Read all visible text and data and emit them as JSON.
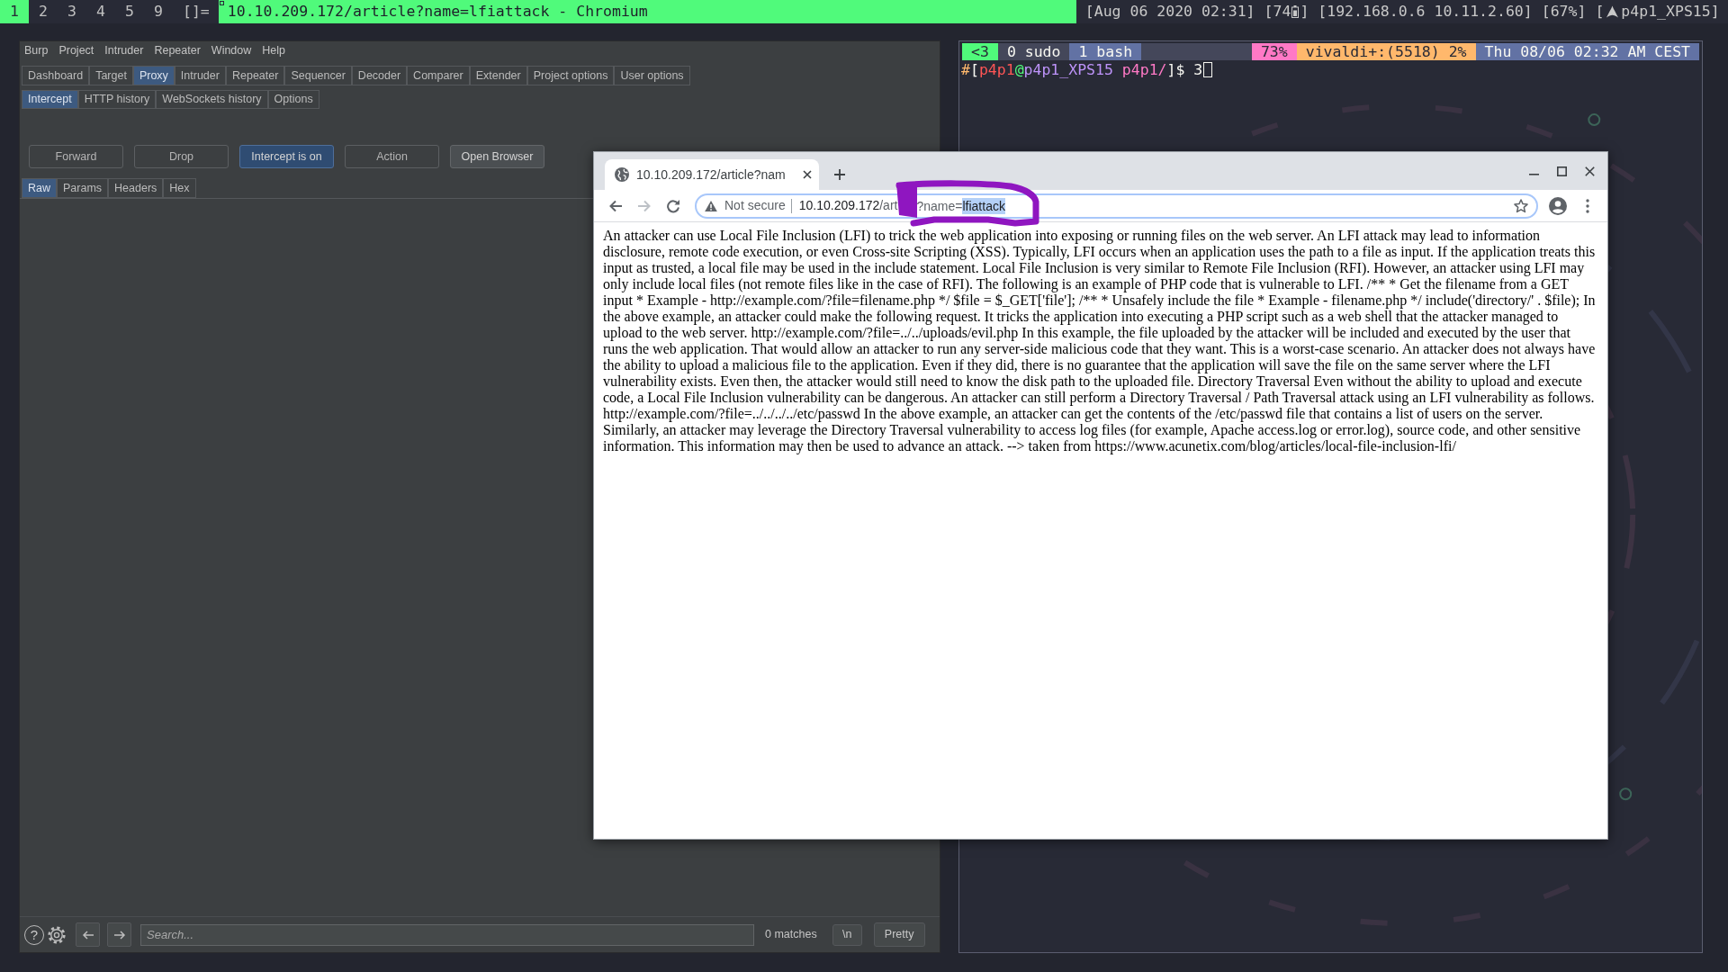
{
  "top_bar": {
    "workspaces": [
      {
        "label": "1",
        "selected": true
      },
      {
        "label": "2",
        "selected": false
      },
      {
        "label": "3",
        "selected": false
      },
      {
        "label": "4",
        "selected": false
      },
      {
        "label": "5",
        "selected": false
      },
      {
        "label": "9",
        "selected": false
      }
    ],
    "layout_symbol": "[]=",
    "window_title": "10.10.209.172/article?name=lfiattack - Chromium",
    "status": [
      {
        "kind": "text",
        "text": "[Aug 06 2020 02:31]"
      },
      {
        "kind": "battery",
        "before": "[74",
        "after": "]"
      },
      {
        "kind": "text",
        "text": "[192.168.0.6 10.11.2.60]"
      },
      {
        "kind": "text",
        "text": "[67%]"
      },
      {
        "kind": "logo",
        "before": "[",
        "after": "p4p1_XPS15]"
      }
    ]
  },
  "burp": {
    "menu": [
      "Burp",
      "Project",
      "Intruder",
      "Repeater",
      "Window",
      "Help"
    ],
    "tabs": [
      {
        "label": "Dashboard",
        "selected": false
      },
      {
        "label": "Target",
        "selected": false
      },
      {
        "label": "Proxy",
        "selected": true
      },
      {
        "label": "Intruder",
        "selected": false
      },
      {
        "label": "Repeater",
        "selected": false
      },
      {
        "label": "Sequencer",
        "selected": false
      },
      {
        "label": "Decoder",
        "selected": false
      },
      {
        "label": "Comparer",
        "selected": false
      },
      {
        "label": "Extender",
        "selected": false
      },
      {
        "label": "Project options",
        "selected": false
      },
      {
        "label": "User options",
        "selected": false
      }
    ],
    "proxy_tabs": [
      {
        "label": "Intercept",
        "selected": true
      },
      {
        "label": "HTTP history",
        "selected": false
      },
      {
        "label": "WebSockets history",
        "selected": false
      },
      {
        "label": "Options",
        "selected": false
      }
    ],
    "actions": [
      {
        "label": "Forward",
        "disabled": true,
        "pressed": false
      },
      {
        "label": "Drop",
        "disabled": true,
        "pressed": false
      },
      {
        "label": "Intercept is on",
        "disabled": false,
        "pressed": true
      },
      {
        "label": "Action",
        "disabled": true,
        "pressed": false
      },
      {
        "label": "Open Browser",
        "disabled": false,
        "pressed": false
      }
    ],
    "editor_tabs": [
      {
        "label": "Raw",
        "selected": true
      },
      {
        "label": "Params",
        "selected": false
      },
      {
        "label": "Headers",
        "selected": false
      },
      {
        "label": "Hex",
        "selected": false
      }
    ],
    "footer": {
      "help": "?",
      "search": {
        "placeholder": "Search..."
      },
      "matches": "0 matches",
      "buttons": [
        "\\n",
        "Pretty"
      ]
    }
  },
  "terminal": {
    "status_left": [
      {
        "text": "<3",
        "color": "#50fa7b"
      },
      {
        "text": "0 sudo",
        "color": "#44475a"
      },
      {
        "text": "1 bash",
        "color": "#6272a4"
      }
    ],
    "status_right": [
      {
        "text": "73%",
        "color": "#ff79c6"
      },
      {
        "text": "vivaldi+:(5518) 2%",
        "color": "#ffb86c"
      },
      {
        "text": "Thu 08/06 02:32 AM CEST",
        "color": "#6272a4"
      }
    ],
    "prompt": [
      {
        "text": "#",
        "color": "#ffb86c"
      },
      {
        "text": "[",
        "color": "#f8f8f2"
      },
      {
        "text": "p4p1",
        "color": "#ff5555"
      },
      {
        "text": "@",
        "color": "#50fa7b"
      },
      {
        "text": "p4p1_XPS15",
        "color": "#bd93f9"
      },
      {
        "text": " p4p1/",
        "color": "#ff79c6"
      },
      {
        "text": "]$ 3",
        "color": "#f8f8f2"
      }
    ]
  },
  "browser": {
    "tab": {
      "title": "10.10.209.172/article?nam"
    },
    "nav": [
      {
        "kind": "back",
        "disabled": false
      },
      {
        "kind": "forward",
        "disabled": true
      },
      {
        "kind": "reload",
        "disabled": false
      }
    ],
    "address": {
      "security": "Not secure",
      "host": "10.10.209.172",
      "path": "/art",
      "query": "?name=",
      "selected_text": "lfiattack"
    },
    "page_text": "An attacker can use Local File Inclusion (LFI) to trick the web application into exposing or running files on the web server. An LFI attack may lead to information disclosure, remote code execution, or even Cross-site Scripting (XSS). Typically, LFI occurs when an application uses the path to a file as input. If the application treats this input as trusted, a local file may be used in the include statement. Local File Inclusion is very similar to Remote File Inclusion (RFI). However, an attacker using LFI may only include local files (not remote files like in the case of RFI). The following is an example of PHP code that is vulnerable to LFI. /** * Get the filename from a GET input * Example - http://example.com/?file=filename.php */ $file = $_GET['file']; /** * Unsafely include the file * Example - filename.php */ include('directory/' . $file); In the above example, an attacker could make the following request. It tricks the application into executing a PHP script such as a web shell that the attacker managed to upload to the web server. http://example.com/?file=../../uploads/evil.php In this example, the file uploaded by the attacker will be included and executed by the user that runs the web application. That would allow an attacker to run any server-side malicious code that they want. This is a worst-case scenario. An attacker does not always have the ability to upload a malicious file to the application. Even if they did, there is no guarantee that the application will save the file on the same server where the LFI vulnerability exists. Even then, the attacker would still need to know the disk path to the uploaded file. Directory Traversal Even without the ability to upload and execute code, a Local File Inclusion vulnerability can be dangerous. An attacker can still perform a Directory Traversal / Path Traversal attack using an LFI vulnerability as follows. http://example.com/?file=../../../../etc/passwd In the above example, an attacker can get the contents of the /etc/passwd file that contains a list of users on the server. Similarly, an attacker may leverage the Directory Traversal vulnerability to access log files (for example, Apache access.log or error.log), source code, and other sensitive information. This information may then be used to advance an attack. --> taken from https://www.acunetix.com/blog/articles/local-file-inclusion-lfi/"
  }
}
